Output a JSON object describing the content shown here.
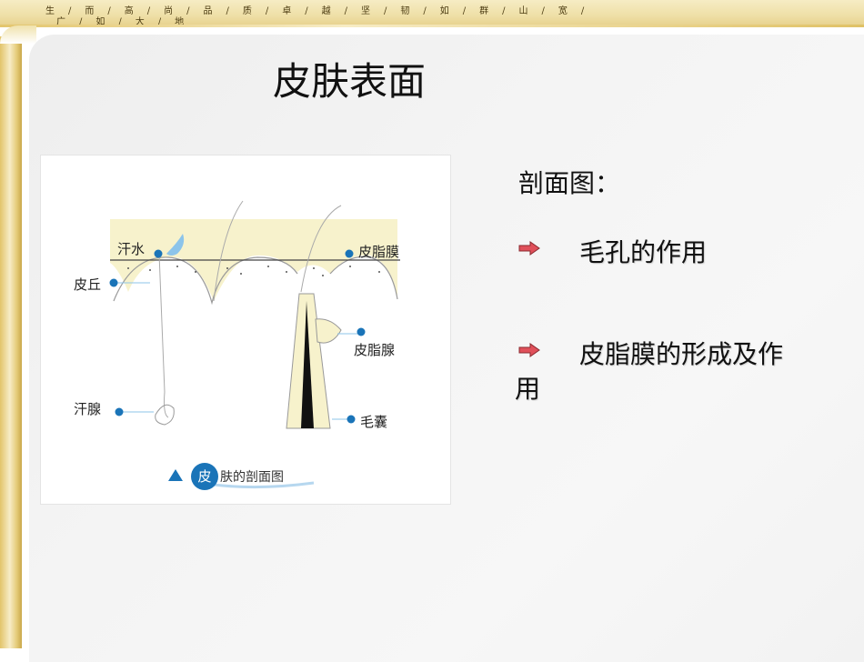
{
  "banner": {
    "row1": [
      "生",
      "/",
      "而",
      "/",
      "高",
      "/",
      "尚",
      "/",
      "品",
      "/",
      "质",
      "/",
      "卓",
      "/",
      "越",
      "/",
      "坚",
      "/",
      "韧",
      "/",
      "如",
      "/",
      "群",
      "/",
      "山",
      "/",
      "宽",
      "/"
    ],
    "row2": [
      "广",
      "/",
      "如",
      "/",
      "大",
      "/",
      "地"
    ]
  },
  "slide": {
    "title": "皮肤表面",
    "subhead": "剖面图：",
    "bullets": [
      {
        "text": "毛孔的作用"
      },
      {
        "text": "皮脂膜的形成及作",
        "cont": "用"
      }
    ]
  },
  "diagram": {
    "labels": {
      "sweat": "汗水",
      "sebum_film": "皮脂膜",
      "skin_ridge": "皮丘",
      "sebaceous_gland": "皮脂腺",
      "sweat_gland": "汗腺",
      "hair_follicle": "毛囊"
    },
    "caption_char": "皮",
    "caption_rest": "肤的剖面图"
  },
  "colors": {
    "accent_blue": "#1a74b8",
    "skin_fill": "#f7f2cc",
    "arrow_red": "#e0505a"
  }
}
